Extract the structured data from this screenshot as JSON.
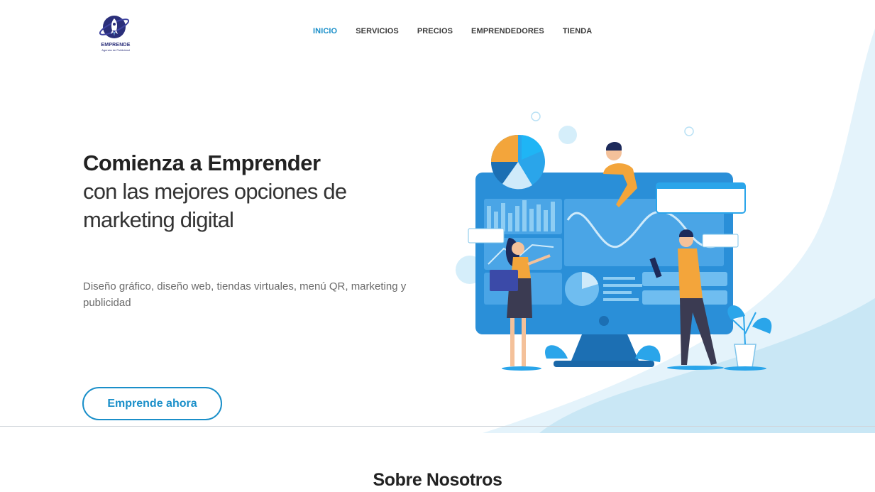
{
  "brand": {
    "name": "EMPRENDE",
    "tagline": "Agencia de Publicidad",
    "accent": "#1a8fc9",
    "logo_color": "#2b2f7a"
  },
  "nav": {
    "items": [
      {
        "label": "INICIO",
        "active": true
      },
      {
        "label": "SERVICIOS",
        "active": false
      },
      {
        "label": "PRECIOS",
        "active": false
      },
      {
        "label": "EMPRENDEDORES",
        "active": false
      },
      {
        "label": "TIENDA",
        "active": false
      }
    ]
  },
  "hero": {
    "title": "Comienza a Emprender",
    "subtitle_line1": "con las mejores opciones de",
    "subtitle_line2": "marketing digital",
    "description": "Diseño gráfico, diseño web, tiendas virtuales, menú QR, marketing y publicidad",
    "cta_label": "Emprende ahora"
  },
  "about": {
    "title": "Sobre Nosotros"
  },
  "illustration": {
    "icon": "marketing-dashboard-illustration"
  }
}
